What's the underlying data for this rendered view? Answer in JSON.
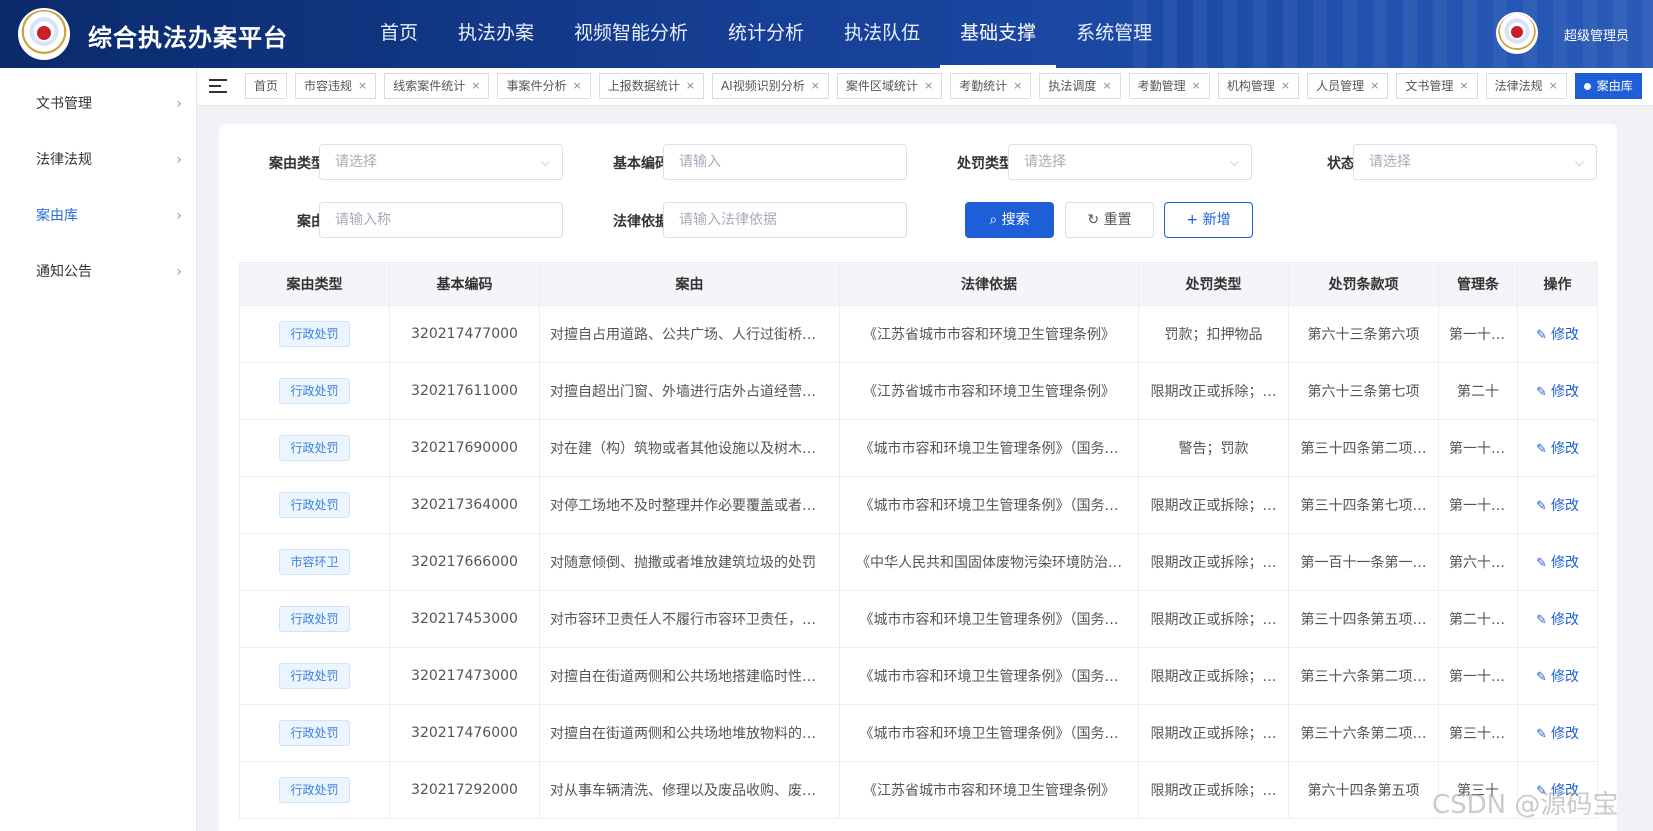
{
  "header": {
    "title": "综合执法办案平台",
    "nav": [
      "首页",
      "执法办案",
      "视频智能分析",
      "统计分析",
      "执法队伍",
      "基础支撑",
      "系统管理"
    ],
    "active_nav": "基础支撑",
    "user": "超级管理员"
  },
  "sidebar": {
    "items": [
      {
        "label": "文书管理",
        "active": false
      },
      {
        "label": "法律法规",
        "active": false
      },
      {
        "label": "案由库",
        "active": true
      },
      {
        "label": "通知公告",
        "active": false
      }
    ]
  },
  "tabs": [
    {
      "label": "首页",
      "closable": false
    },
    {
      "label": "市容违规",
      "closable": true
    },
    {
      "label": "线索案件统计",
      "closable": true
    },
    {
      "label": "事案件分析",
      "closable": true
    },
    {
      "label": "上报数据统计",
      "closable": true
    },
    {
      "label": "AI视频识别分析",
      "closable": true
    },
    {
      "label": "案件区域统计",
      "closable": true
    },
    {
      "label": "考勤统计",
      "closable": true
    },
    {
      "label": "执法调度",
      "closable": true
    },
    {
      "label": "考勤管理",
      "closable": true
    },
    {
      "label": "机构管理",
      "closable": true
    },
    {
      "label": "人员管理",
      "closable": true
    },
    {
      "label": "文书管理",
      "closable": true
    },
    {
      "label": "法律法规",
      "closable": true
    },
    {
      "label": "案由库",
      "closable": true,
      "active": true
    }
  ],
  "filters": {
    "case_type": {
      "label": "案由类型",
      "placeholder": "请选择"
    },
    "base_code": {
      "label": "基本编码",
      "placeholder": "请输入"
    },
    "penalty_type": {
      "label": "处罚类型",
      "placeholder": "请选择"
    },
    "status": {
      "label": "状态",
      "placeholder": "请选择"
    },
    "case_name": {
      "label": "案由",
      "placeholder": "请输入称"
    },
    "legal_basis": {
      "label": "法律依据",
      "placeholder": "请输入法律依据"
    }
  },
  "buttons": {
    "search": "搜索",
    "reset": "重置",
    "add": "新增"
  },
  "table": {
    "columns": [
      "案由类型",
      "基本编码",
      "案由",
      "法律依据",
      "处罚类型",
      "处罚条款项",
      "管理条",
      "操作"
    ],
    "edit_label": "修改",
    "rows": [
      {
        "type": "行政处罚",
        "code": "320217477000",
        "reason": "对擅自占用道路、公共广场、人行过街桥…",
        "basis": "《江苏省城市市容和环境卫生管理条例》",
        "penalty": "罚款；扣押物品",
        "clause": "第六十三条第六项",
        "mgmt": "第一十九条"
      },
      {
        "type": "行政处罚",
        "code": "320217611000",
        "reason": "对擅自超出门窗、外墙进行店外占道经营…",
        "basis": "《江苏省城市市容和环境卫生管理条例》",
        "penalty": "限期改正或拆除；…",
        "clause": "第六十三条第七项",
        "mgmt": "第二十"
      },
      {
        "type": "行政处罚",
        "code": "320217690000",
        "reason": "对在建（构）筑物或者其他设施以及树木…",
        "basis": "《城市市容和环境卫生管理条例》（国务…",
        "penalty": "警告；罚款",
        "clause": "第三十四条第二项…",
        "mgmt": "第一十七条"
      },
      {
        "type": "行政处罚",
        "code": "320217364000",
        "reason": "对停工场地不及时整理并作必要覆盖或者…",
        "basis": "《城市市容和环境卫生管理条例》（国务…",
        "penalty": "限期改正或拆除；…",
        "clause": "第三十四条第七项…",
        "mgmt": "第一十六条"
      },
      {
        "type": "市容环卫",
        "code": "320217666000",
        "reason": "对随意倾倒、抛撒或者堆放建筑垃圾的处罚",
        "basis": "《中华人民共和国固体废物污染环境防治…",
        "penalty": "限期改正或拆除；…",
        "clause": "第一百十一条第一…",
        "mgmt": "第六十三条"
      },
      {
        "type": "行政处罚",
        "code": "320217453000",
        "reason": "对市容环卫责任人不履行市容环卫责任，…",
        "basis": "《城市市容和环境卫生管理条例》（国务…",
        "penalty": "限期改正或拆除；…",
        "clause": "第三十四条第五项…",
        "mgmt": "第二十三条"
      },
      {
        "type": "行政处罚",
        "code": "320217473000",
        "reason": "对擅自在街道两侧和公共场地搭建临时性…",
        "basis": "《城市市容和环境卫生管理条例》（国务…",
        "penalty": "限期改正或拆除；…",
        "clause": "第三十六条第二项…",
        "mgmt": "第一十四条"
      },
      {
        "type": "行政处罚",
        "code": "320217476000",
        "reason": "对擅自在街道两侧和公共场地堆放物料的…",
        "basis": "《城市市容和环境卫生管理条例》（国务…",
        "penalty": "限期改正或拆除；…",
        "clause": "第三十六条第二项…",
        "mgmt": "第三十六条"
      },
      {
        "type": "行政处罚",
        "code": "320217292000",
        "reason": "对从事车辆清洗、修理以及废品收购、废…",
        "basis": "《江苏省城市市容和环境卫生管理条例》",
        "penalty": "限期改正或拆除；…",
        "clause": "第六十四条第五项",
        "mgmt": "第三十"
      }
    ]
  },
  "watermark": "CSDN @源码宝"
}
